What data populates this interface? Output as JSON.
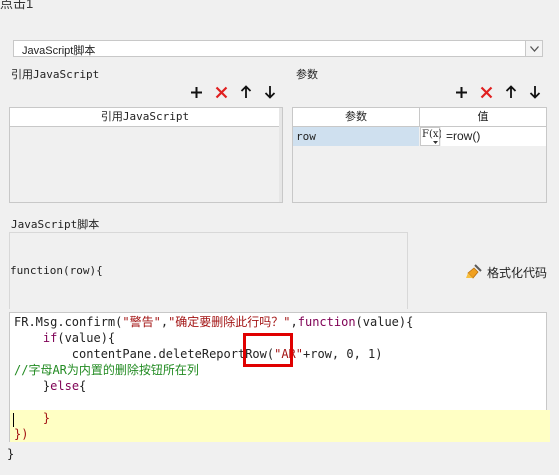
{
  "window": {
    "title": "点击1"
  },
  "dropdown": {
    "selected": "JavaScript脚本"
  },
  "left_section": {
    "label": "引用JavaScript",
    "column_header": "引用JavaScript"
  },
  "right_section": {
    "label": "参数",
    "columns": [
      "参数",
      "值"
    ],
    "rows": [
      {
        "name": "row",
        "formula_label": "F(x)",
        "value": "=row()"
      }
    ]
  },
  "script_section": {
    "label": "JavaScript脚本",
    "signature": "function(row){",
    "format_button": "格式化代码"
  },
  "code": {
    "l1": {
      "a": "FR.Msg.confirm(",
      "s1": "\"警告\"",
      "c1": ",",
      "s2": "\"确定要删除此行吗？\"",
      "c2": ",",
      "kw": "function",
      "rest": "(value){"
    },
    "l2": {
      "indent": "    ",
      "kw": "if",
      "rest": "(value){"
    },
    "l3": {
      "indent": "        ",
      "a": "contentPane.deleteReportRow(",
      "s": "\"AR\"",
      "rest": "+row, 0, 1)"
    },
    "l4": {
      "comment": "//字母AR为内置的删除按钮所在列"
    },
    "l5": {
      "indent": "    ",
      "a": "}",
      "kw": "else",
      "rest": "{"
    },
    "l6": {
      "text": ""
    },
    "l7": {
      "indent": "    ",
      "text": "}"
    },
    "l8": {
      "text": "})"
    }
  },
  "closing": "}"
}
